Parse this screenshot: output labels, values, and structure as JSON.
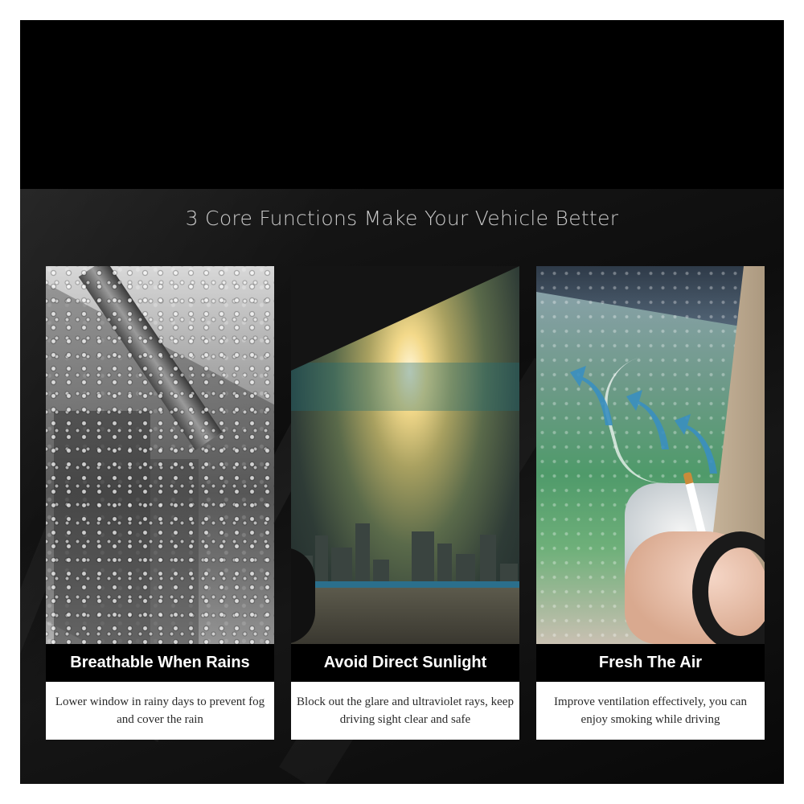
{
  "headline": "3 Core Functions Make Your Vehicle Better",
  "features": [
    {
      "title": "Breathable When Rains",
      "description": "Lower window in rainy days to prevent fog and cover the rain",
      "image_icon": "rainy-window-photo"
    },
    {
      "title": "Avoid Direct Sunlight",
      "description": "Block out the glare and ultraviolet rays, keep driving sight clear and safe",
      "image_icon": "sunlight-window-photo"
    },
    {
      "title": "Fresh The Air",
      "description": "Improve ventilation effectively, you can enjoy smoking while driving",
      "image_icon": "ventilation-photo"
    }
  ],
  "colors": {
    "background": "#000000",
    "headline_text": "#c9c9c9",
    "label_bar": "#000000",
    "label_text": "#ffffff",
    "description_bg": "#ffffff",
    "description_text": "#2a2a2a",
    "arrow": "#3a8fc0"
  }
}
